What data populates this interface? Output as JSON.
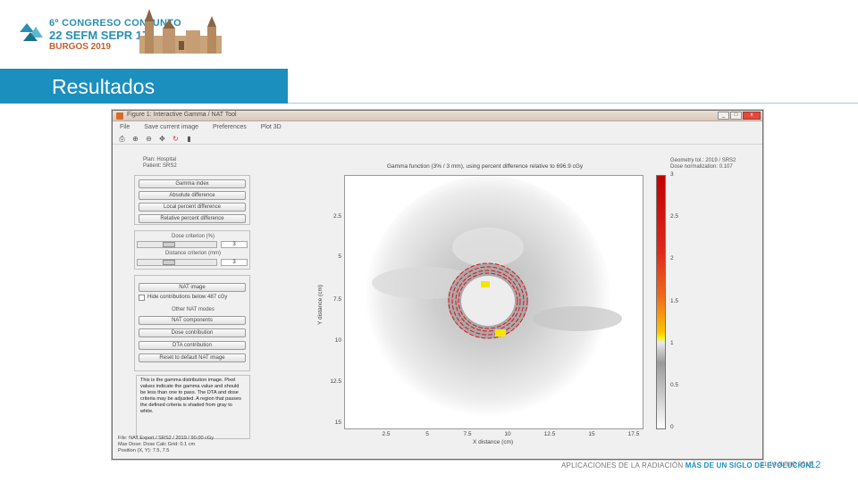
{
  "slide": {
    "title": "Resultados",
    "logo": {
      "line1": "6º CONGRESO CONJUNTO",
      "line2": "22 SEFM SEPR 17",
      "line3": "BURGOS 2019"
    },
    "footer": {
      "part1": "APLICACIONES DE LA RADIACIÓN",
      "part2": "MÁS DE UN SIGLO DE EVOLUCIÓN",
      "date": "11-14 JUNIO 2019"
    },
    "page_number": "12",
    "accent_color": "#1b8fbd"
  },
  "window": {
    "title": "Figure 1: Interactive Gamma / NAT Tool",
    "controls": [
      "_",
      "□",
      "x"
    ],
    "menu": [
      "File",
      "Save current image",
      "Preferences",
      "Plot 3D"
    ],
    "toolbar_icons": [
      "print-icon",
      "zoom-in-icon",
      "zoom-out-icon",
      "pan-icon",
      "rotate-icon",
      "colorbar-icon"
    ]
  },
  "left_panel": {
    "info_lines": [
      "Plan: Hospital",
      "Patient: SRS2"
    ],
    "mode_buttons": [
      "Gamma index",
      "Absolute difference",
      "Local percent difference",
      "Relative percent difference"
    ],
    "dose_criterion_label": "Dose criterion (%)",
    "dose_criterion_value": "3",
    "distance_criterion_label": "Distance criterion (mm)",
    "distance_criterion_value": "3",
    "nat_button": "NAT image",
    "hide_checkbox_label": "Hide contributions below 487 cGy",
    "other_label": "Other NAT modes",
    "nat_mode_buttons": [
      "NAT components",
      "Dose contribution",
      "DTA contribution",
      "Reset to default NAT image"
    ],
    "description": "This is the gamma distribution image. Pixel values indicate the gamma value and should be less than one to pass. The DTA and dose criteria may be adjusted. A region that passes the defined criteria is shaded from gray to white.",
    "footer_lines": [
      "File: NAT Export / SRS2 / 2019 / 90.00 cGy",
      "Max Dose: Dose Calc Grid: 0.1 cm",
      "Position (X, Y): 7.5, 7.5"
    ]
  },
  "figure": {
    "title": "Gamma function (3% / 3 mm), using percent difference relative to 696.9 cGy",
    "right_info": [
      "Geometry tol.: 2019 / SRS2",
      "Dose normalization: 0.107"
    ],
    "xlabel": "X distance (cm)",
    "ylabel": "Y distance (cm)",
    "x_ticks": [
      "2.5",
      "5",
      "7.5",
      "10",
      "12.5",
      "15",
      "17.5"
    ],
    "y_ticks": [
      "2.5",
      "5",
      "7.5",
      "10",
      "12.5",
      "15"
    ],
    "colorbar_ticks": [
      "3",
      "2.5",
      "2",
      "1.5",
      "1",
      "0.5",
      "0"
    ]
  }
}
